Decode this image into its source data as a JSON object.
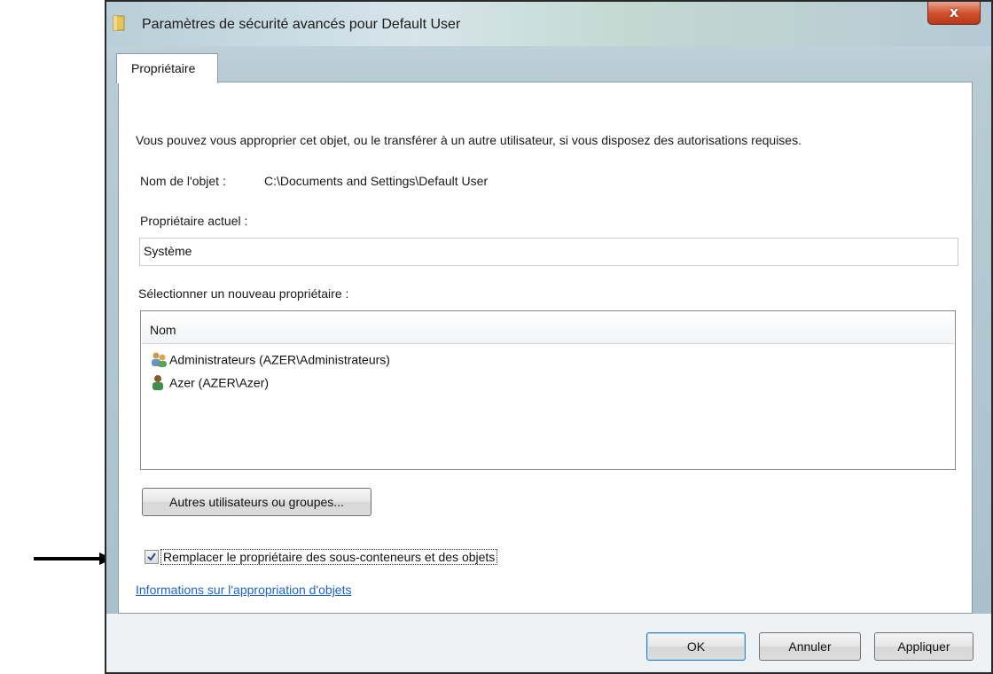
{
  "window": {
    "title": "Paramètres de sécurité avancés pour Default User",
    "close_label": "x"
  },
  "tabs": [
    {
      "label": "Propriétaire",
      "selected": true
    }
  ],
  "main": {
    "description": "Vous pouvez vous approprier cet objet, ou le transférer à un autre utilisateur, si vous disposez des autorisations requises.",
    "object_name_label": "Nom de l'objet :",
    "object_name_value": "C:\\Documents and Settings\\Default User",
    "current_owner_label": "Propriétaire actuel :",
    "current_owner_value": "Système",
    "new_owner_label": "Sélectionner un nouveau propriétaire :",
    "owner_list": {
      "column_header": "Nom",
      "items": [
        {
          "label": "Administrateurs (AZER\\Administrateurs)",
          "icon": "user-group-icon"
        },
        {
          "label": "Azer (AZER\\Azer)",
          "icon": "user-icon"
        }
      ]
    },
    "other_users_button": "Autres utilisateurs ou groupes...",
    "replace_checkbox": {
      "label": "Remplacer le propriétaire des sous-conteneurs et des objets",
      "checked": true
    },
    "help_link": "Informations sur l'appropriation d'objets"
  },
  "footer": {
    "ok": "OK",
    "cancel": "Annuler",
    "apply": "Appliquer"
  },
  "colors": {
    "link": "#1c64c4",
    "close_button": "#c9472a"
  }
}
